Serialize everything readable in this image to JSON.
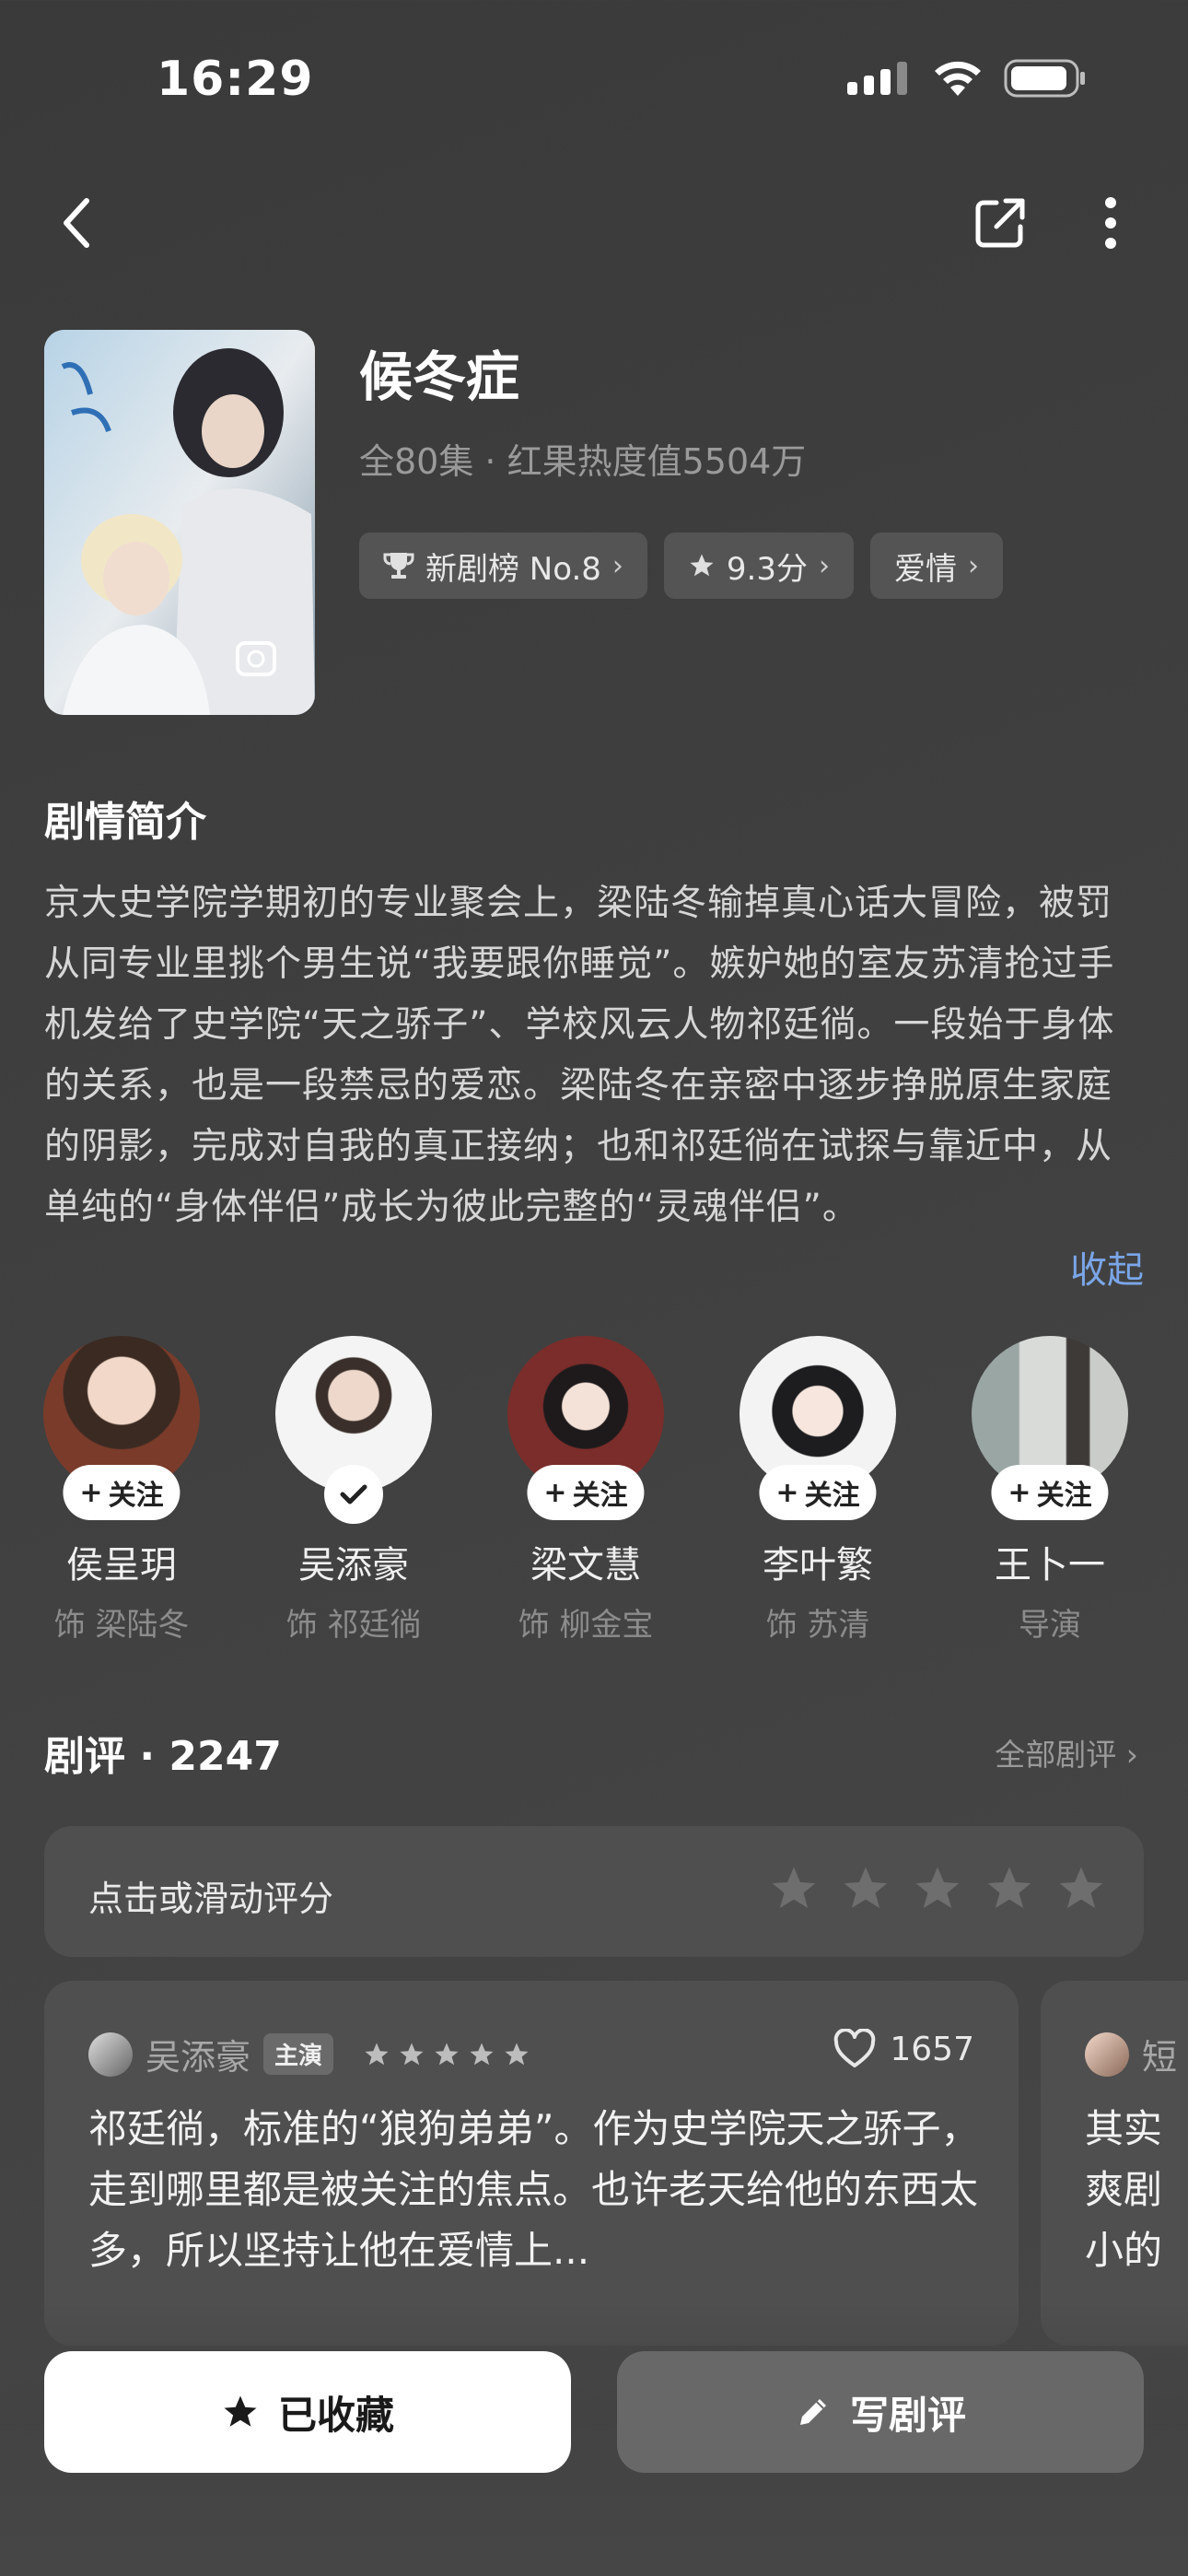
{
  "status_bar": {
    "time": "16:29"
  },
  "show": {
    "title": "候冬症",
    "meta": "全80集 · 红果热度值5504万",
    "chips": [
      {
        "icon": "trophy-icon",
        "label": "新剧榜 No.8"
      },
      {
        "icon": "star-icon",
        "label": "9.3分"
      },
      {
        "icon": "",
        "label": "爱情"
      }
    ]
  },
  "synopsis": {
    "title": "剧情简介",
    "text": "京大史学院学期初的专业聚会上，梁陆冬输掉真心话大冒险，被罚从同专业里挑个男生说“我要跟你睡觉”。嫉妒她的室友苏清抢过手机发给了史学院“天之骄子”、学校风云人物祁廷徜。一段始于身体的关系，也是一段禁忌的爱恋。梁陆冬在亲密中逐步挣脱原生家庭的阴影，完成对自我的真正接纳；也和祁廷徜在试探与靠近中，从单纯的“身体伴侣”成长为彼此完整的“灵魂伴侣”。",
    "collapse_label": "收起"
  },
  "cast": [
    {
      "name": "侯呈玥",
      "role": "饰 梁陆冬",
      "follow_label": "关注",
      "followed": false
    },
    {
      "name": "吴添豪",
      "role": "饰 祁廷徜",
      "follow_label": "",
      "followed": true
    },
    {
      "name": "梁文慧",
      "role": "饰 柳金宝",
      "follow_label": "关注",
      "followed": false
    },
    {
      "name": "李叶繁",
      "role": "饰 苏清",
      "follow_label": "关注",
      "followed": false
    },
    {
      "name": "王卜一",
      "role": "导演",
      "follow_label": "关注",
      "followed": false
    }
  ],
  "reviews": {
    "title": "剧评 · 2247",
    "all_label": "全部剧评",
    "rate_prompt": "点击或滑动评分",
    "items": [
      {
        "author": "吴添豪",
        "badge": "主演",
        "stars": 5,
        "likes": "1657",
        "text": "祁廷徜，标准的“狼狗弟弟”。作为史学院天之骄子，走到哪里都是被关注的焦点。也许老天给他的东西太多，所以坚持让他在爱情上..."
      },
      {
        "author": "短",
        "lines": [
          "其实",
          "爽剧",
          "小的"
        ]
      }
    ]
  },
  "actions": {
    "favorite_label": "已收藏",
    "write_label": "写剧评"
  }
}
